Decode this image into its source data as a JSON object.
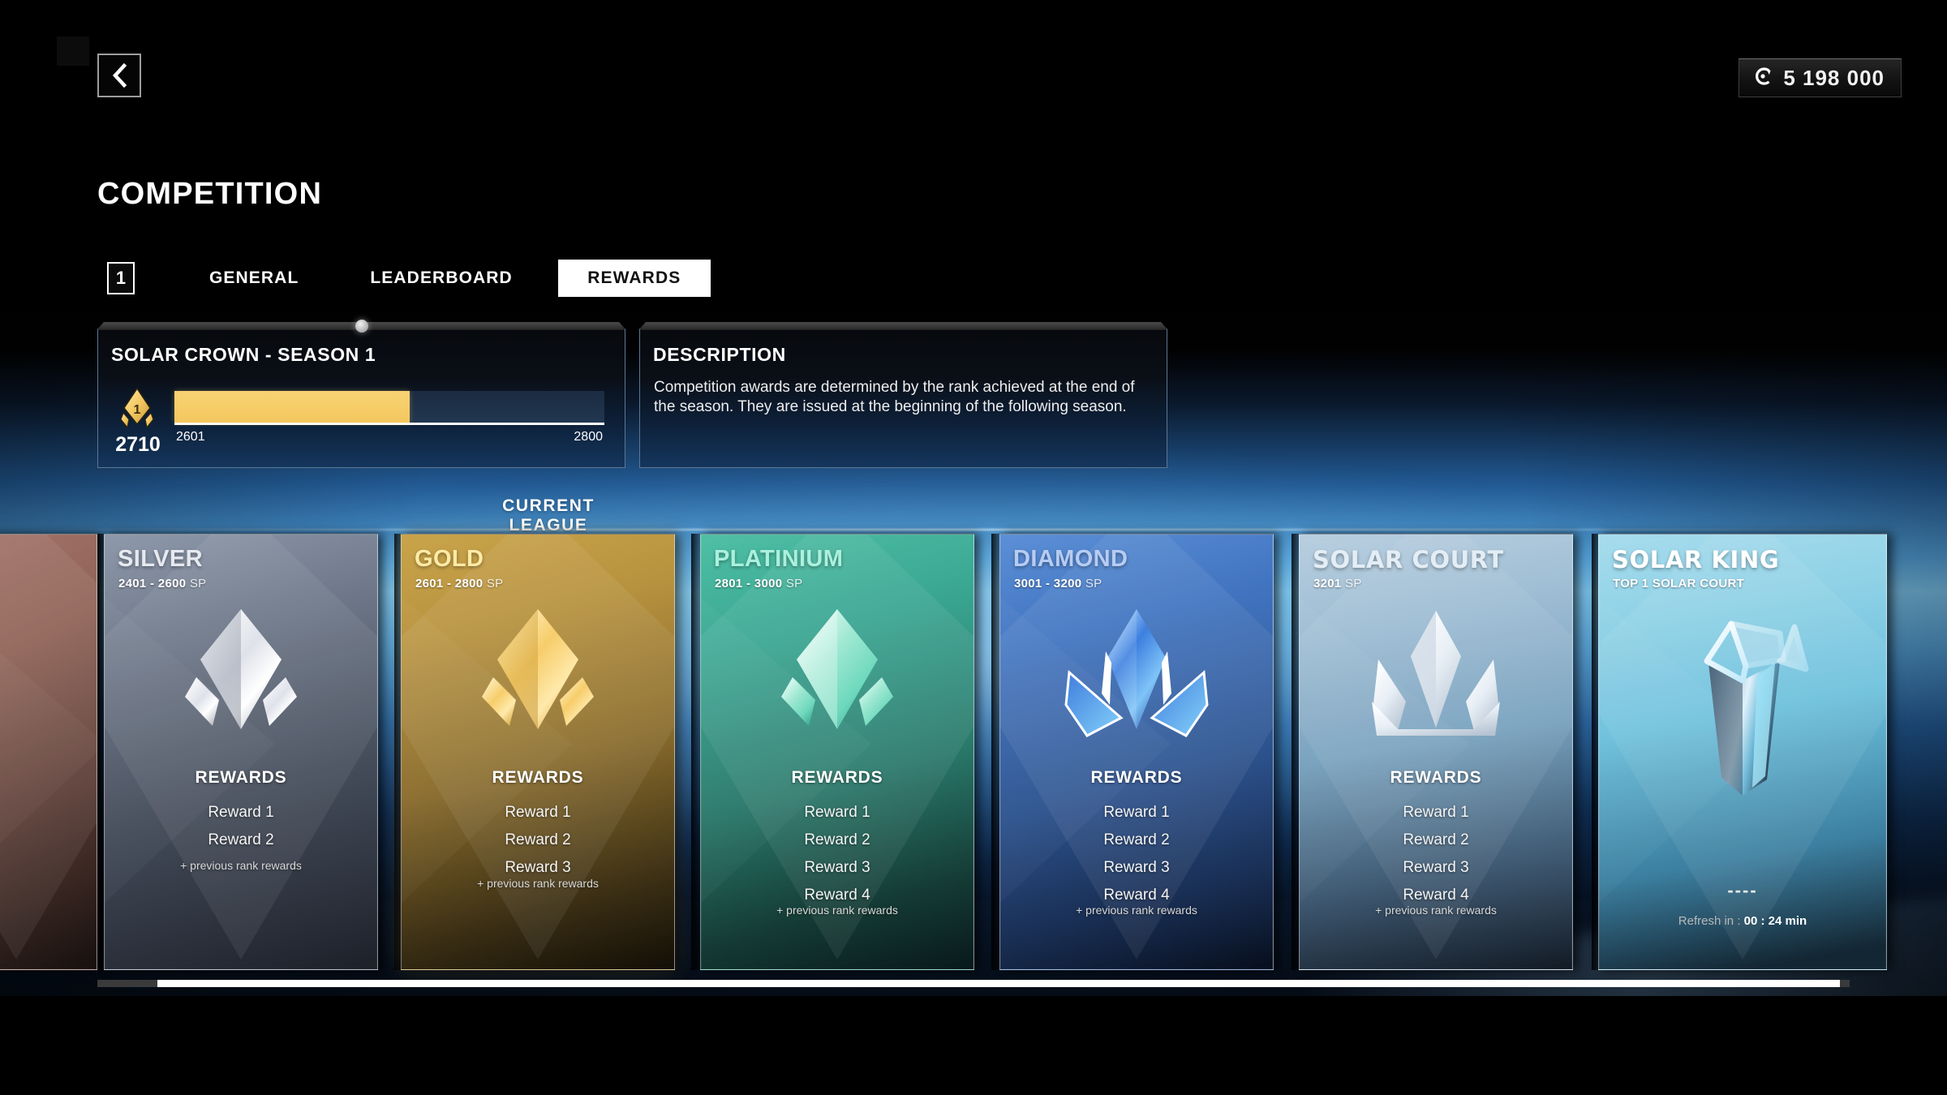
{
  "window": {
    "back_icon": "chevron-left-icon"
  },
  "header": {
    "currency_icon": "coin-icon",
    "currency_value": "5 198 000",
    "page_title": "COMPETITION"
  },
  "tabs": {
    "badge": "1",
    "items": [
      {
        "label": "GENERAL",
        "active": false
      },
      {
        "label": "LEADERBOARD",
        "active": false
      },
      {
        "label": "REWARDS",
        "active": true
      }
    ]
  },
  "season_panel": {
    "title": "SOLAR CROWN - SEASON 1",
    "rank_badge": "1",
    "current_sp": "2710",
    "range_min": "2601",
    "range_max": "2800",
    "progress_percent": 54.8
  },
  "description_panel": {
    "title": "DESCRIPTION",
    "text": "Competition awards are determined by the rank achieved at the end of the season. They are issued at the beginning of the following season."
  },
  "current_league_marker": {
    "label": "CURRENT LEAGUE"
  },
  "leagues": [
    {
      "id": "bronze",
      "name": "",
      "sp_range": "",
      "emblem": "bronze-crystal-emblem",
      "rewards_heading": "",
      "rewards": [],
      "note": ""
    },
    {
      "id": "silver",
      "name": "SILVER",
      "sp_range": "2401 - 2600",
      "sp_unit": "SP",
      "emblem": "silver-crystal-emblem",
      "rewards_heading": "REWARDS",
      "rewards": [
        "Reward 1",
        "Reward 2"
      ],
      "note": "+ previous rank rewards"
    },
    {
      "id": "gold",
      "name": "GOLD",
      "sp_range": "2601 - 2800",
      "sp_unit": "SP",
      "emblem": "gold-crystal-emblem",
      "rewards_heading": "REWARDS",
      "rewards": [
        "Reward 1",
        "Reward 2",
        "Reward 3"
      ],
      "note": "+ previous rank rewards",
      "is_current": true
    },
    {
      "id": "platinium",
      "name": "PLATINIUM",
      "sp_range": "2801 - 3000",
      "sp_unit": "SP",
      "emblem": "platinium-crystal-emblem",
      "rewards_heading": "REWARDS",
      "rewards": [
        "Reward 1",
        "Reward 2",
        "Reward 3",
        "Reward 4"
      ],
      "note": "+ previous rank rewards"
    },
    {
      "id": "diamond",
      "name": "DIAMOND",
      "sp_range": "3001 - 3200",
      "sp_unit": "SP",
      "emblem": "diamond-crystal-emblem",
      "rewards_heading": "REWARDS",
      "rewards": [
        "Reward 1",
        "Reward 2",
        "Reward 3",
        "Reward 4"
      ],
      "note": "+ previous rank rewards"
    },
    {
      "id": "solarcourt",
      "name": "SOLAR COURT",
      "sp_range": "3201",
      "sp_unit": "SP",
      "emblem": "solar-court-crown-emblem",
      "rewards_heading": "REWARDS",
      "rewards": [
        "Reward 1",
        "Reward 2",
        "Reward 3",
        "Reward 4"
      ],
      "note": "+ previous rank rewards"
    },
    {
      "id": "solarking",
      "name": "SOLAR KING",
      "sp_range": "TOP 1 SOLAR COURT",
      "sp_unit": "",
      "emblem": "solar-king-trophy-emblem",
      "rewards_heading": "",
      "rewards": [],
      "dashes": "----",
      "refresh_label": "Refresh in :",
      "refresh_value": "00 : 24 min"
    }
  ],
  "colors": {
    "accent_gold": "#f4c75e",
    "active_tab_bg": "#ffffff",
    "panel_border": "#5d7794",
    "silver": "#8e99ab",
    "gold": "#c9a44a",
    "platinium": "#4fbfa5",
    "diamond": "#5b8fd6",
    "solar_court": "#9dbcd3",
    "solar_king": "#8ed1e6",
    "bronze": "#a5756b"
  },
  "scrollbar": {
    "orientation": "horizontal",
    "thumb_percent": 96
  }
}
